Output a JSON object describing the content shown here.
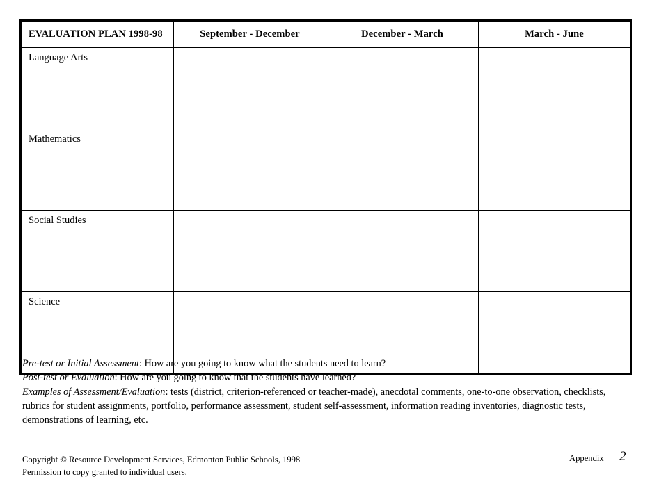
{
  "table": {
    "headers": {
      "subject": "EVALUATION PLAN 1998-98",
      "terms": [
        "September - December",
        "December - March",
        "March - June"
      ]
    },
    "rows": [
      {
        "subject": "Language Arts",
        "entries": [
          "",
          "",
          ""
        ]
      },
      {
        "subject": "Mathematics",
        "entries": [
          "",
          "",
          ""
        ]
      },
      {
        "subject": "Social Studies",
        "entries": [
          "",
          "",
          ""
        ]
      },
      {
        "subject": "Science",
        "entries": [
          "",
          "",
          ""
        ]
      }
    ]
  },
  "notes": [
    {
      "lead": "Pre-test or Initial Assessment",
      "body": ":  How are you going to know what the students need to learn?"
    },
    {
      "lead": "Post-test or Evaluation",
      "body": ":  How are you going to know that the students have learned?"
    },
    {
      "lead": "Examples of Assessment/Evaluation",
      "body": ":  tests (district, criterion-referenced or teacher-made), anecdotal comments, one-to-one observation, checklists, rubrics for student assignments, portfolio, performance assessment, student self-assessment, information reading inventories, diagnostic tests, demonstrations of learning, etc."
    }
  ],
  "footer": {
    "copyright_line1": "Copyright © Resource Development Services, Edmonton Public Schools, 1998",
    "copyright_line2": "Permission to copy granted to individual users.",
    "appendix_label": "Appendix",
    "page_number": "2"
  }
}
